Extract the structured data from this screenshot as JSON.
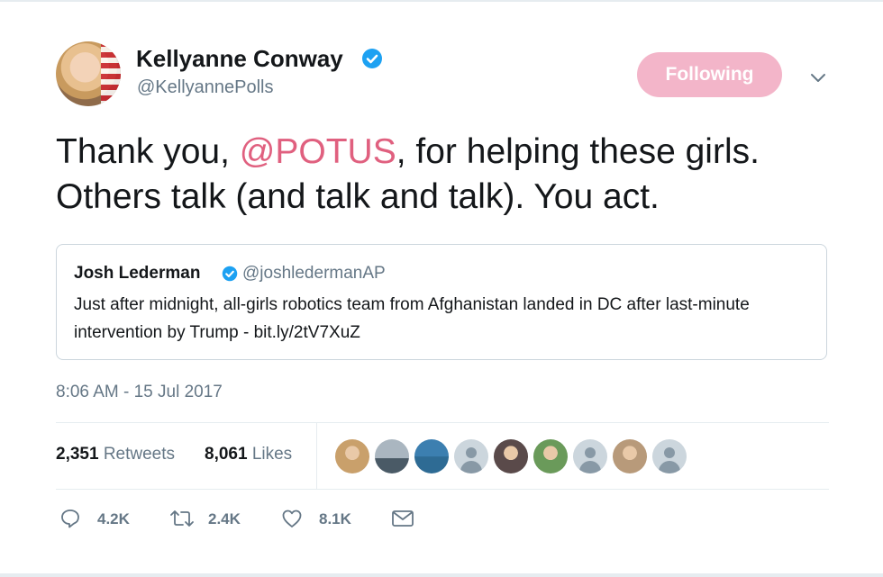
{
  "author": {
    "name": "Kellyanne Conway",
    "handle": "@KellyannePolls",
    "verified": true
  },
  "follow_button": {
    "label": "Following",
    "color": "#f3b5c9"
  },
  "tweet": {
    "text_before": "Thank you, ",
    "mention": "@POTUS",
    "text_after": ", for helping these girls. Others talk (and talk and talk). You act.",
    "mention_color": "#e0607f"
  },
  "quoted_tweet": {
    "name": "Josh Lederman",
    "handle": "@joshledermanAP",
    "verified": true,
    "text": "Just after midnight, all-girls robotics team from Afghanistan landed in DC after last-minute intervention by Trump - bit.ly/2tV7XuZ"
  },
  "timestamp": "8:06 AM - 15 Jul 2017",
  "stats": {
    "retweets_count": "2,351",
    "retweets_label": "Retweets",
    "likes_count": "8,061",
    "likes_label": "Likes"
  },
  "likers": [
    {
      "icon": "user-photo-icon",
      "bg": "#c9a06b"
    },
    {
      "icon": "ship-photo-icon",
      "bg": "#7d8c99"
    },
    {
      "icon": "landscape-photo-icon",
      "bg": "#3c7fb0"
    },
    {
      "icon": "default-user-icon",
      "bg": "#ccd6dd"
    },
    {
      "icon": "user-photo-icon",
      "bg": "#5a4a4a"
    },
    {
      "icon": "user-photo-icon",
      "bg": "#6a9a5a"
    },
    {
      "icon": "default-user-icon",
      "bg": "#ccd6dd"
    },
    {
      "icon": "user-photo-icon",
      "bg": "#b89a7a"
    },
    {
      "icon": "default-user-icon",
      "bg": "#ccd6dd"
    }
  ],
  "actions": {
    "reply_count": "4.2K",
    "retweet_count": "2.4K",
    "like_count": "8.1K"
  },
  "colors": {
    "verified_blue": "#1da1f2",
    "secondary_text": "#657786",
    "divider": "#e6ecf0"
  }
}
